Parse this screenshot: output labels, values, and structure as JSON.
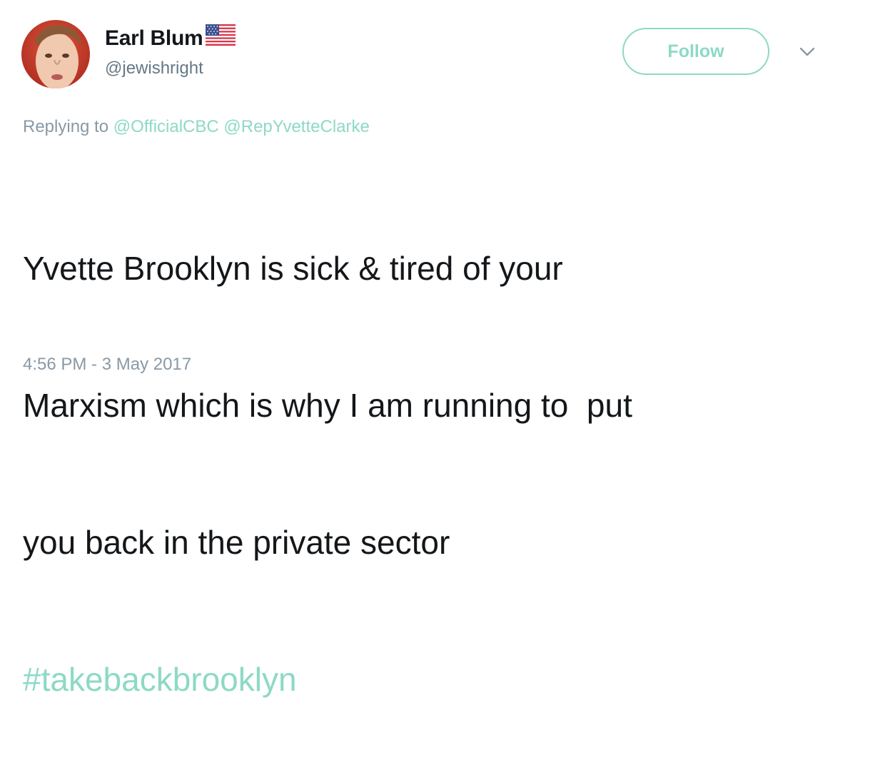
{
  "user": {
    "display_name": "Earl Blum",
    "handle": "@jewishright",
    "flag_icon": "us-flag-icon"
  },
  "actions": {
    "follow_label": "Follow",
    "more_icon": "chevron-down-icon"
  },
  "reply": {
    "prefix": "Replying to",
    "mentions": [
      "@OfficialCBC",
      "@RepYvetteClarke"
    ]
  },
  "tweet": {
    "lines": [
      "Yvette Brooklyn is sick & tired of your",
      "Marxism which is why I am running to  put",
      "you back in the private sector"
    ],
    "hashtag": "#takebackbrooklyn"
  },
  "timestamp": "4:56 PM - 3 May 2017",
  "colors": {
    "accent": "#8dd9c6",
    "text": "#14171a",
    "secondary": "#657786",
    "muted": "#8899a6"
  }
}
